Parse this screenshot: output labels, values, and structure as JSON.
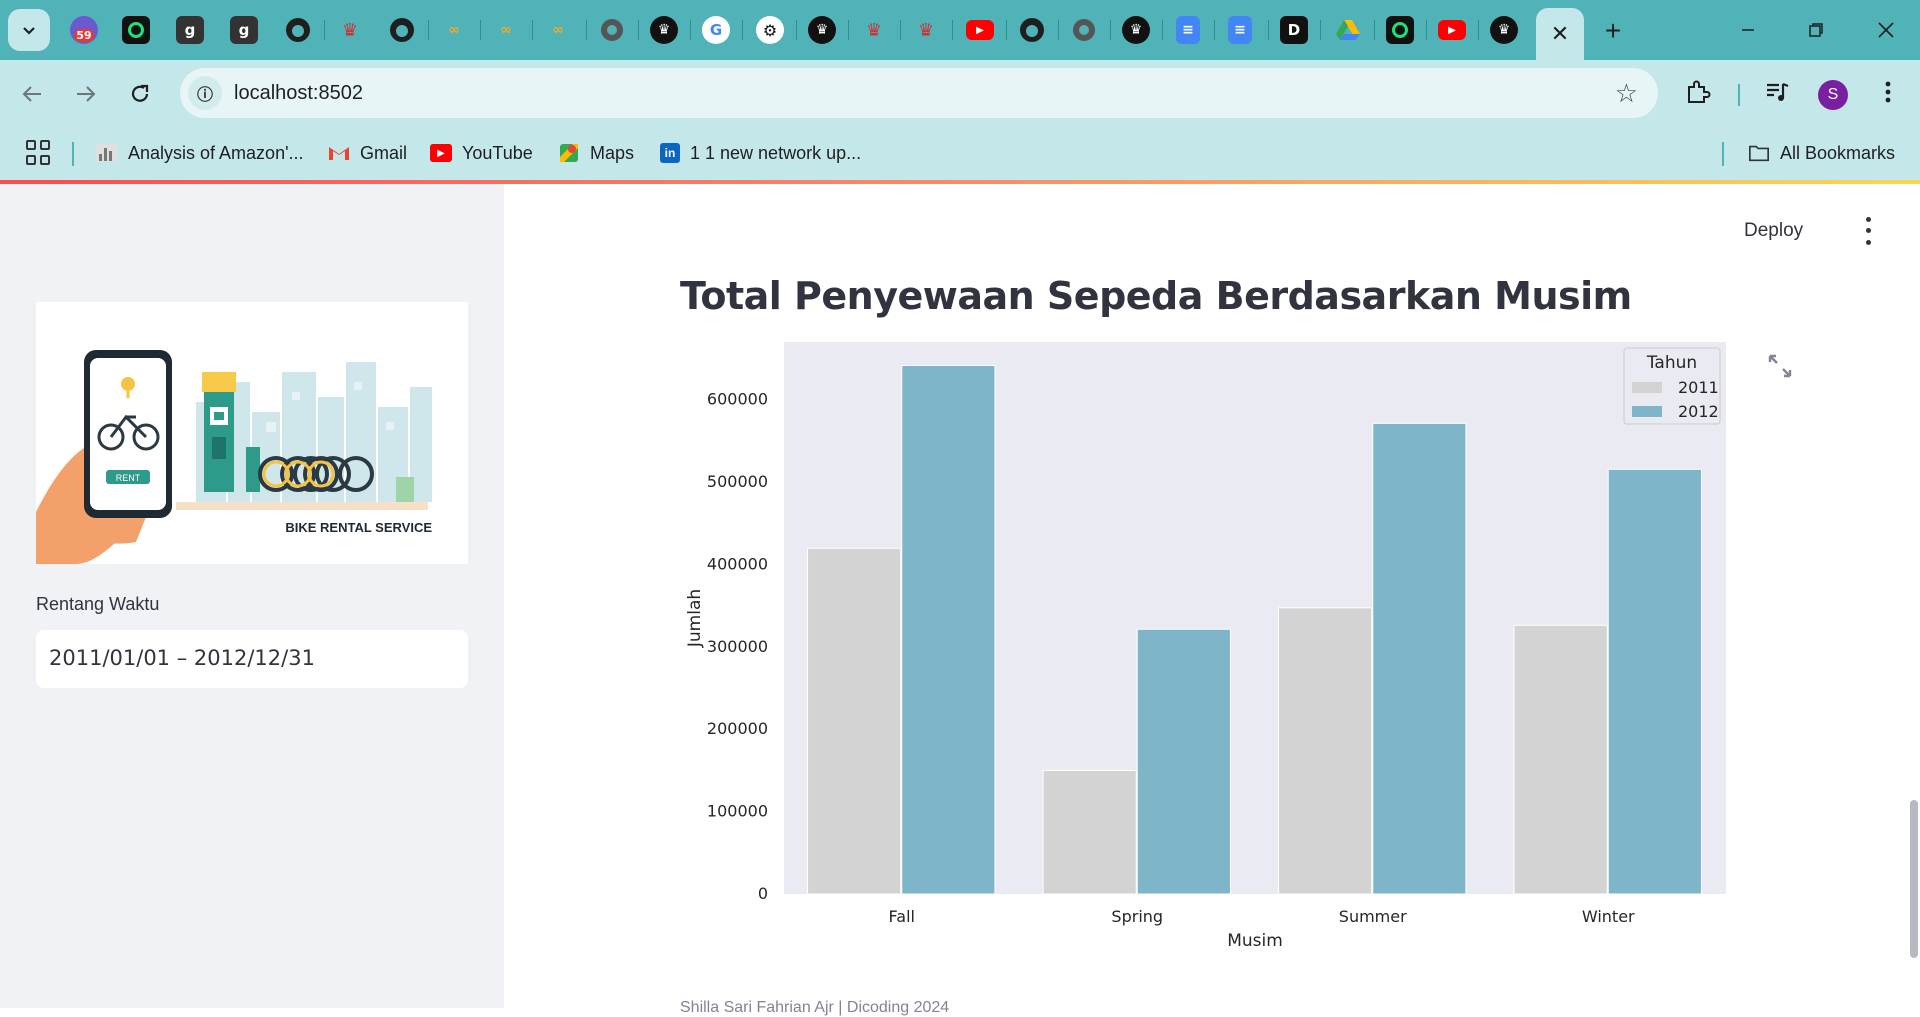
{
  "browser": {
    "tabs_badge": "59",
    "bookmarks": [
      {
        "label": "Analysis of Amazon'...",
        "icon": "analysis-icon"
      },
      {
        "label": "Gmail",
        "icon": "gmail-icon"
      },
      {
        "label": "YouTube",
        "icon": "youtube-icon"
      },
      {
        "label": "Maps",
        "icon": "maps-icon"
      },
      {
        "label": "1 1 new network up...",
        "icon": "linkedin-icon"
      }
    ],
    "all_bookmarks": "All Bookmarks",
    "url": "localhost:8502",
    "avatar_letter": "S",
    "accent": "#4fb3b8"
  },
  "sidebar": {
    "hero_text": "BIKE RENTAL SERVICE",
    "hero_rent": "RENT",
    "date_label": "Rentang Waktu",
    "date_value": "2011/01/01 – 2012/12/31"
  },
  "main": {
    "deploy": "Deploy",
    "title": "Total Penyewaan Sepeda Berdasarkan Musim",
    "caption": "Shilla Sari Fahrian Ajr | Dicoding 2024"
  },
  "chart_data": {
    "type": "bar",
    "categories": [
      "Fall",
      "Spring",
      "Summer",
      "Winter"
    ],
    "series": [
      {
        "name": "2011",
        "values": [
          419650,
          150000,
          347316,
          326137
        ],
        "color": "#d3d3d3"
      },
      {
        "name": "2012",
        "values": [
          641479,
          321348,
          571273,
          515476
        ],
        "color": "#7fb5c8"
      }
    ],
    "xlabel": "Musim",
    "ylabel": "Jumlah",
    "legend_title": "Tahun",
    "legend_position": "top-right",
    "ylim": [
      0,
      670000
    ],
    "yticks": [
      0,
      100000,
      200000,
      300000,
      400000,
      500000,
      600000
    ],
    "grid": false,
    "background": "#eaeaf2"
  }
}
